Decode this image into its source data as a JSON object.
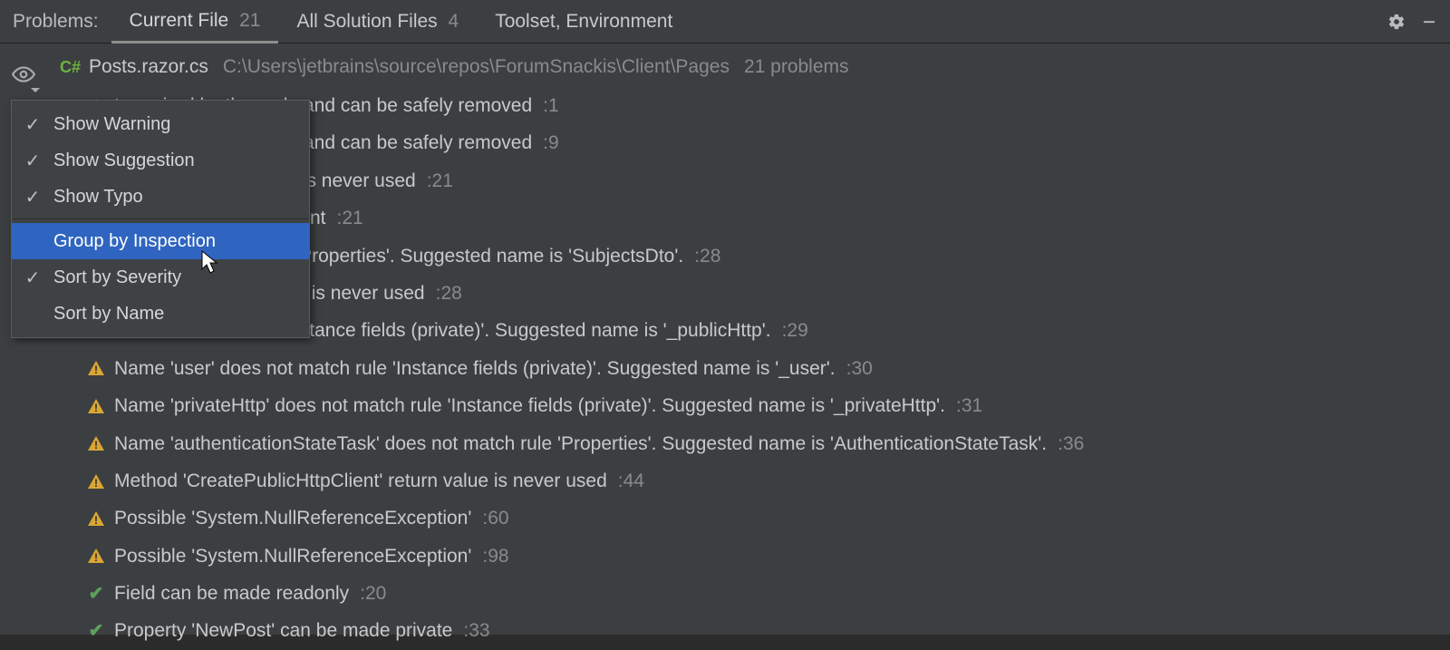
{
  "header": {
    "label": "Problems:",
    "tabs": [
      {
        "label": "Current File",
        "count": "21",
        "active": true
      },
      {
        "label": "All Solution Files",
        "count": "4",
        "active": false
      },
      {
        "label": "Toolset, Environment",
        "count": "",
        "active": false
      }
    ]
  },
  "file": {
    "icon_text": "C#",
    "name": "Posts.razor.cs",
    "path": "C:\\Users\\jetbrains\\source\\repos\\ForumSnackis\\Client\\Pages",
    "problems": "21 problems"
  },
  "issues": [
    {
      "type": "warn",
      "text": "t required by the code and can be safely removed",
      "line": ":1"
    },
    {
      "type": "warn",
      "text": "t required by the code and can be safely removed",
      "line": ":9"
    },
    {
      "type": "warn",
      "text": "assigned but its value is never used",
      "line": ":21"
    },
    {
      "type": "warn",
      "text": "lefault value is redundant",
      "line": ":21"
    },
    {
      "type": "warn",
      "text": "' does not match rule 'Properties'. Suggested name is 'SubjectsDto'.",
      "line": ":28"
    },
    {
      "type": "warn",
      "text": "ssor 'SubjectsDTO.set' is never used",
      "line": ":28"
    },
    {
      "type": "warn",
      "text": "loes not match rule 'Instance fields (private)'. Suggested name is '_publicHttp'.",
      "line": ":29"
    },
    {
      "type": "warn",
      "text": "Name 'user' does not match rule 'Instance fields (private)'. Suggested name is '_user'.",
      "line": ":30"
    },
    {
      "type": "warn",
      "text": "Name 'privateHttp' does not match rule 'Instance fields (private)'. Suggested name is '_privateHttp'.",
      "line": ":31"
    },
    {
      "type": "warn",
      "text": "Name 'authenticationStateTask' does not match rule 'Properties'. Suggested name is 'AuthenticationStateTask'.",
      "line": ":36"
    },
    {
      "type": "warn",
      "text": "Method 'CreatePublicHttpClient' return value is never used",
      "line": ":44"
    },
    {
      "type": "warn",
      "text": "Possible 'System.NullReferenceException'",
      "line": ":60"
    },
    {
      "type": "warn",
      "text": "Possible 'System.NullReferenceException'",
      "line": ":98"
    },
    {
      "type": "ok",
      "text": "Field can be made readonly",
      "line": ":20"
    },
    {
      "type": "ok",
      "text": "Property 'NewPost' can be made private",
      "line": ":33"
    }
  ],
  "menu": {
    "items": [
      {
        "label": "Show Warning",
        "checked": true
      },
      {
        "label": "Show Suggestion",
        "checked": true
      },
      {
        "label": "Show Typo",
        "checked": true
      }
    ],
    "items2": [
      {
        "label": "Group by Inspection",
        "checked": false,
        "highlight": true
      },
      {
        "label": "Sort by Severity",
        "checked": true
      },
      {
        "label": "Sort by Name",
        "checked": false
      }
    ]
  }
}
